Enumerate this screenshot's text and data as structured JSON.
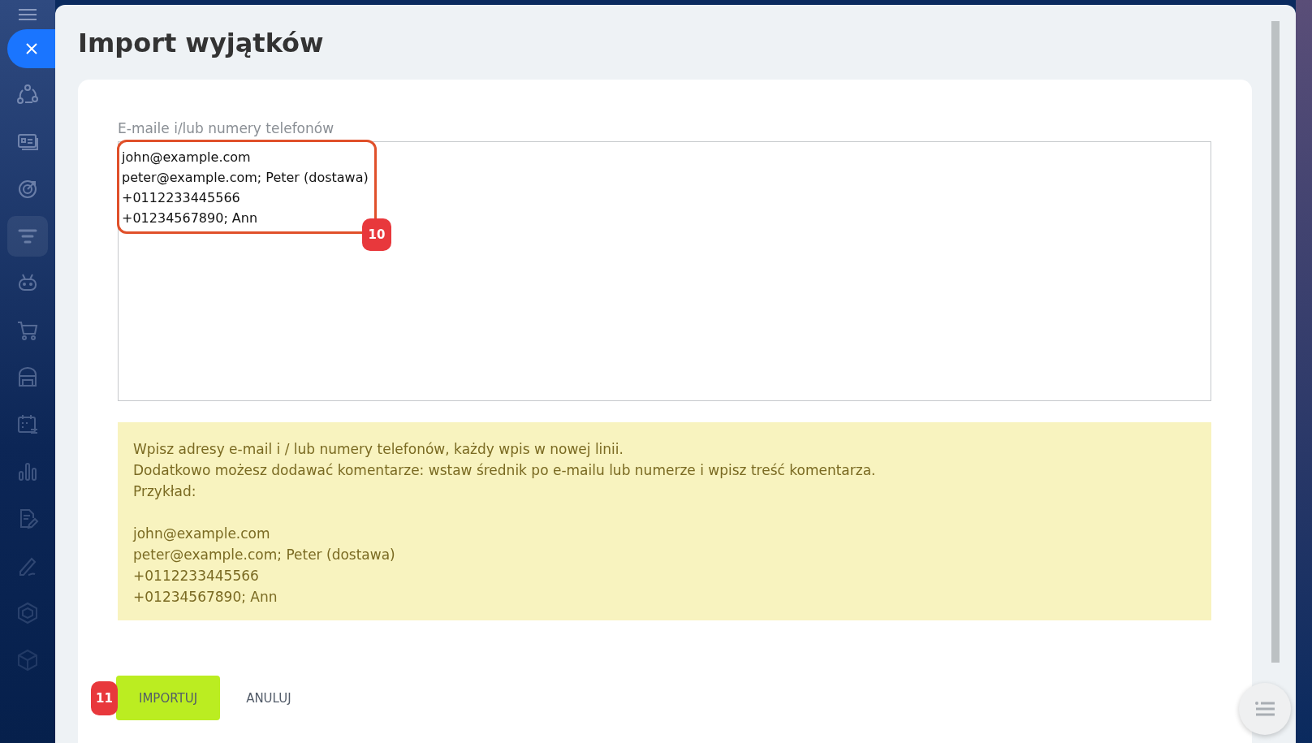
{
  "title": "Import wyjątków",
  "field": {
    "label": "E-maile i/lub numery telefonów",
    "value": "john@example.com\npeter@example.com; Peter (dostawa)\n+0112233445566\n+01234567890; Ann"
  },
  "hint": {
    "lines": [
      "Wpisz adresy e-mail i / lub numery telefonów, każdy wpis w nowej linii.",
      "Dodatkowo możesz dodawać komentarze: wstaw średnik po e-mailu lub numerze i wpisz treść komentarza.",
      "Przykład:"
    ],
    "example": [
      "john@example.com",
      "peter@example.com; Peter (dostawa)",
      "+0112233445566",
      "+01234567890; Ann"
    ]
  },
  "buttons": [
    {
      "label": "IMPORTUJ",
      "kind": "primary"
    },
    {
      "label": "ANULUJ",
      "kind": "link"
    }
  ],
  "annotations": [
    {
      "number": "10"
    },
    {
      "number": "11"
    }
  ]
}
